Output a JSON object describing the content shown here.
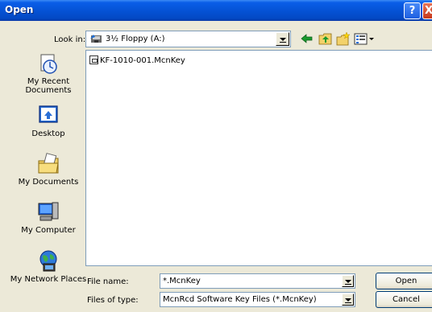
{
  "dialog": {
    "title": "Open"
  },
  "titlebar": {
    "help_glyph": "?",
    "close_glyph": "X"
  },
  "lookin": {
    "label": "Look in:",
    "value": "3½ Floppy (A:)",
    "icon": "floppy-drive-icon"
  },
  "toolbar": {
    "back": "back-arrow-icon",
    "up": "up-one-level-icon",
    "new_folder": "new-folder-icon",
    "views": "views-menu-icon"
  },
  "places": [
    {
      "label": "My Recent Documents",
      "icon": "recent-documents-icon"
    },
    {
      "label": "Desktop",
      "icon": "desktop-icon"
    },
    {
      "label": "My Documents",
      "icon": "my-documents-icon"
    },
    {
      "label": "My Computer",
      "icon": "my-computer-icon"
    },
    {
      "label": "My Network Places",
      "icon": "network-places-icon"
    }
  ],
  "files": [
    {
      "name": "KF-1010-001.McnKey",
      "icon": "key-file-icon"
    }
  ],
  "filename": {
    "label": "File name:",
    "value": "*.McnKey"
  },
  "filetype": {
    "label": "Files of type:",
    "value": "McnRcd Software Key Files (*.McnKey)"
  },
  "buttons": {
    "open": "Open",
    "cancel": "Cancel"
  },
  "colors": {
    "titlebar": "#0553d6",
    "dialog_bg": "#ece9d8",
    "field_border": "#7f9db9"
  }
}
